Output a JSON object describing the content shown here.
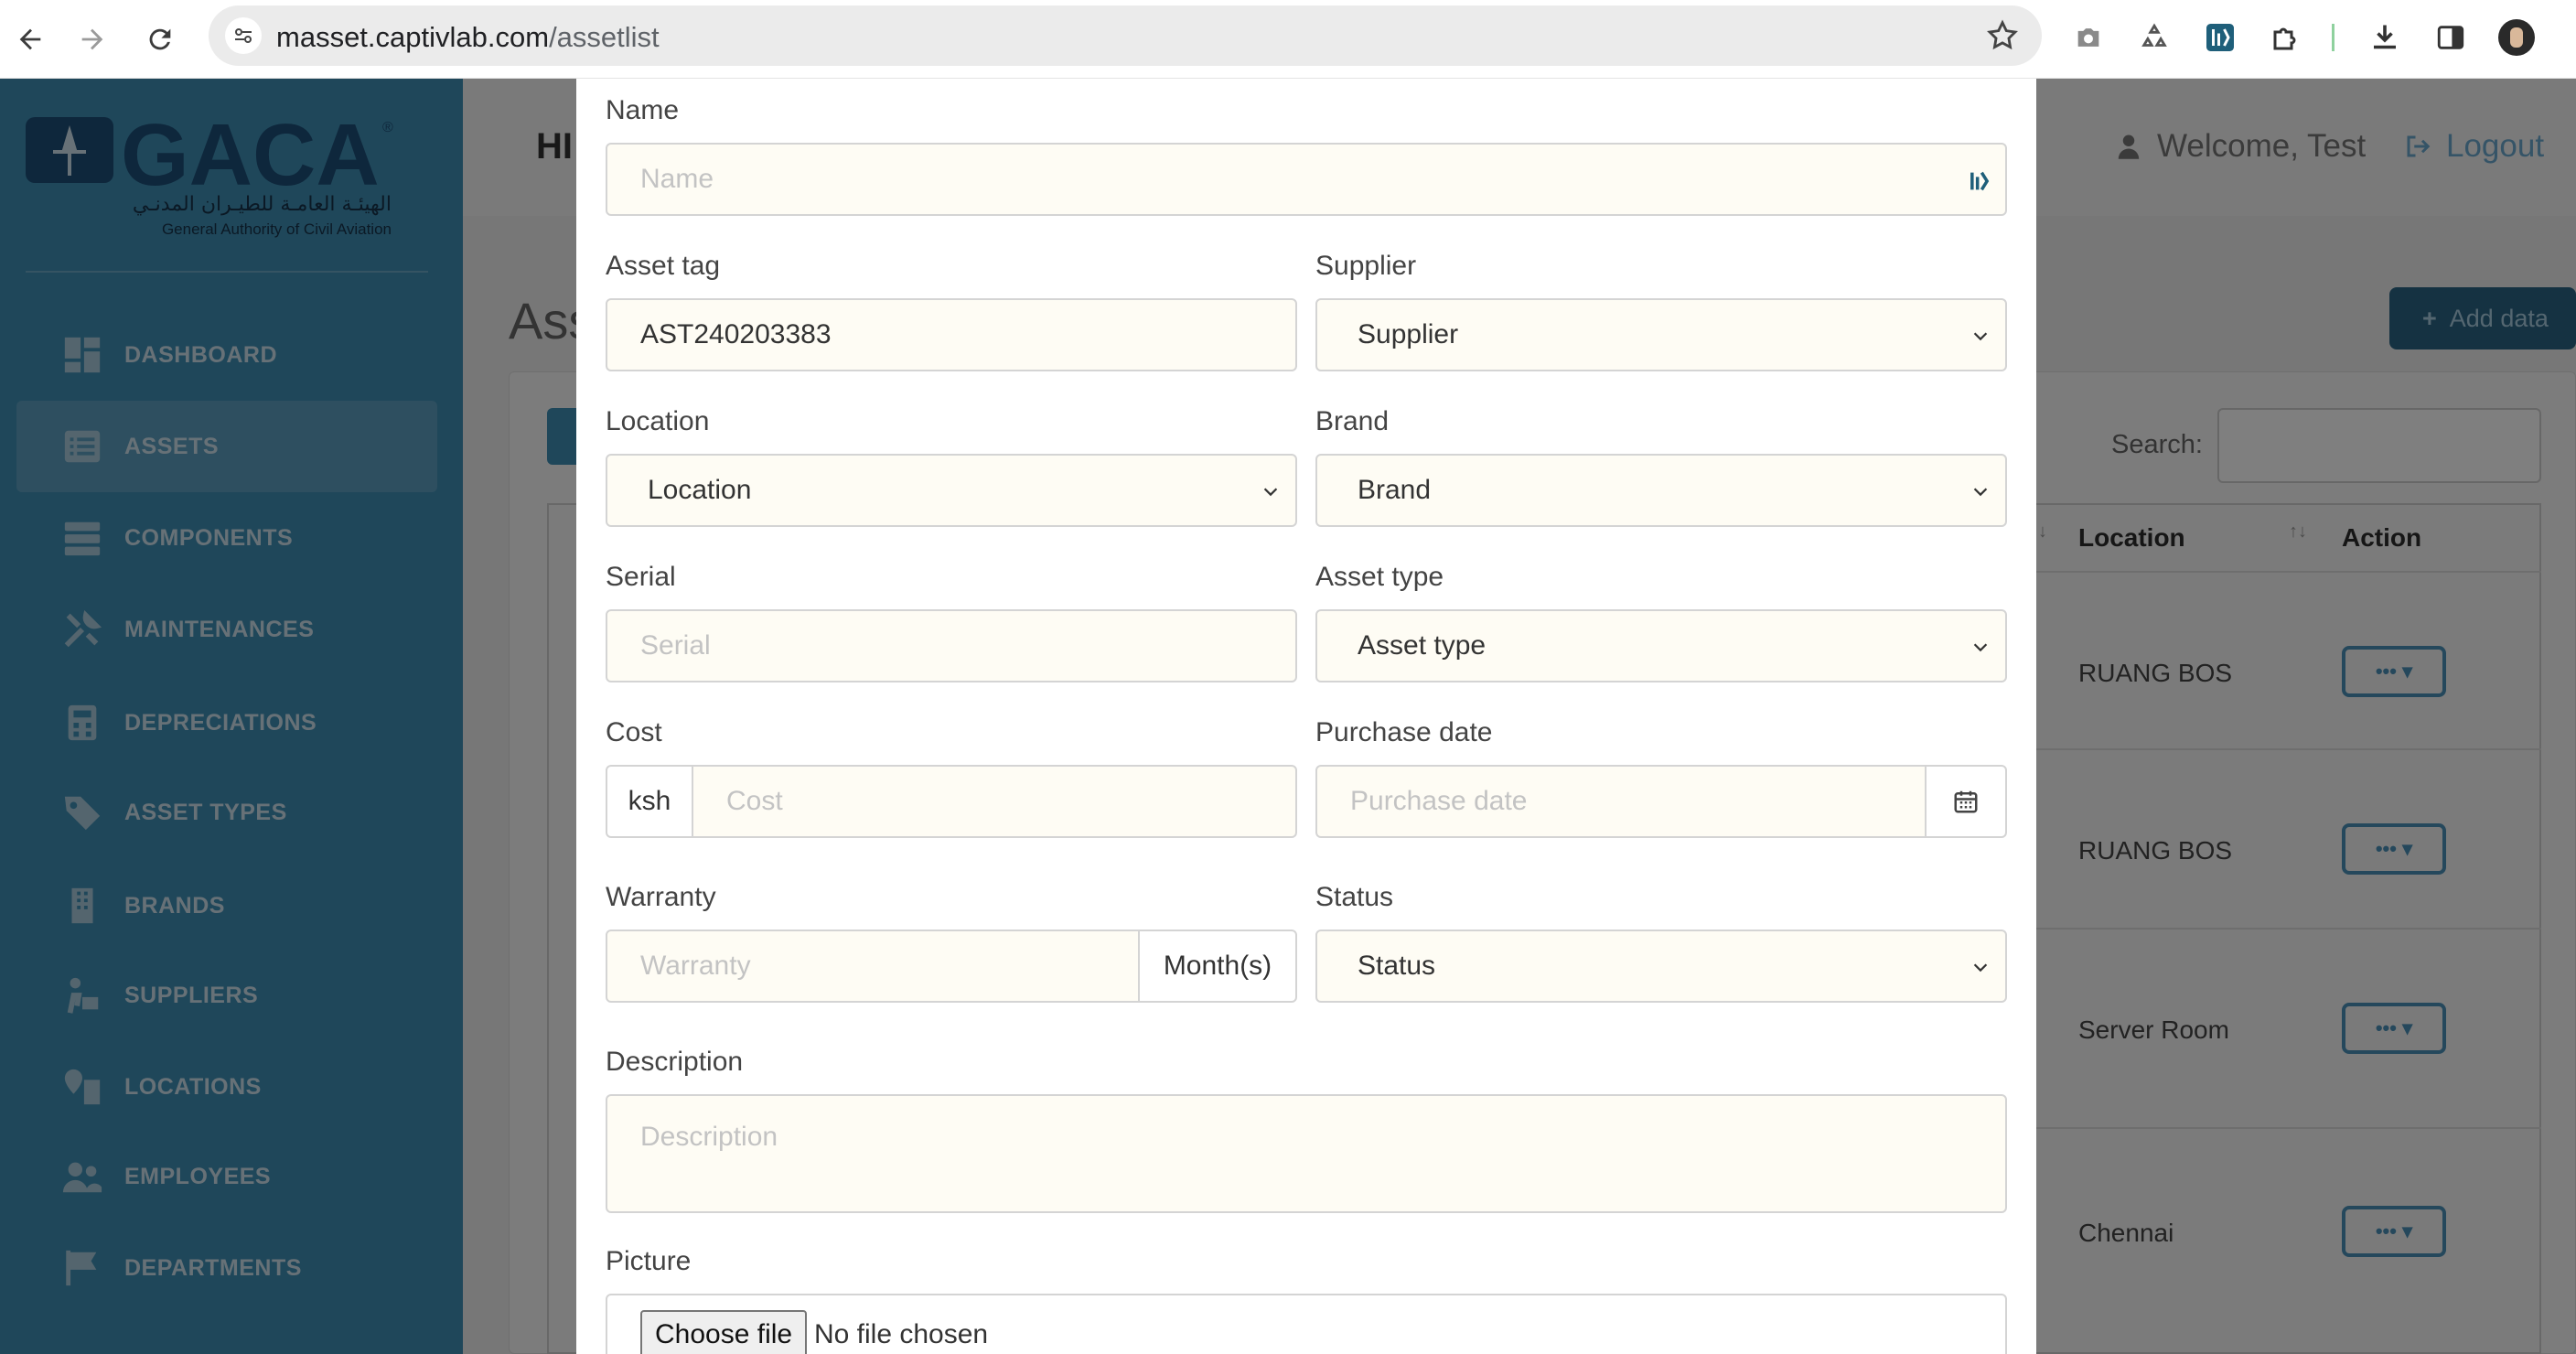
{
  "browser": {
    "url_host": "masset.captivlab.com",
    "url_path": "/assetlist"
  },
  "sidebar": {
    "logo_text": "GACA",
    "logo_arabic": "الهيئـة العامـة للطيـران المدنـي",
    "logo_sub": "General Authority of Civil Aviation",
    "items": [
      {
        "label": "DASHBOARD",
        "icon": "dashboard-icon"
      },
      {
        "label": "ASSETS",
        "icon": "list-icon",
        "active": true
      },
      {
        "label": "COMPONENTS",
        "icon": "server-icon"
      },
      {
        "label": "MAINTENANCES",
        "icon": "tools-icon"
      },
      {
        "label": "DEPRECIATIONS",
        "icon": "calculator-icon"
      },
      {
        "label": "ASSET TYPES",
        "icon": "tag-icon"
      },
      {
        "label": "BRANDS",
        "icon": "building-icon"
      },
      {
        "label": "SUPPLIERS",
        "icon": "dolly-icon"
      },
      {
        "label": "LOCATIONS",
        "icon": "map-pin-icon"
      },
      {
        "label": "EMPLOYEES",
        "icon": "users-icon"
      },
      {
        "label": "DEPARTMENTS",
        "icon": "flag-icon"
      }
    ]
  },
  "header": {
    "title_partial": "HI",
    "welcome": "Welcome, Test",
    "logout": "Logout"
  },
  "page": {
    "heading_partial": "Ass",
    "add_button": "Add data",
    "search_label": "Search:"
  },
  "table": {
    "headers": {
      "location": "Location",
      "action": "Action"
    },
    "rows": [
      {
        "location": "RUANG BOS"
      },
      {
        "location": "RUANG BOS"
      },
      {
        "location": "Server Room"
      },
      {
        "location": "Chennai"
      }
    ],
    "action_glyph": "•••"
  },
  "form": {
    "name": {
      "label": "Name",
      "placeholder": "Name"
    },
    "asset_tag": {
      "label": "Asset tag",
      "value": "AST240203383"
    },
    "supplier": {
      "label": "Supplier",
      "selected": "Supplier"
    },
    "location": {
      "label": "Location",
      "selected": "Location"
    },
    "brand": {
      "label": "Brand",
      "selected": "Brand"
    },
    "serial": {
      "label": "Serial",
      "placeholder": "Serial"
    },
    "asset_type": {
      "label": "Asset type",
      "selected": "Asset type"
    },
    "cost": {
      "label": "Cost",
      "prefix": "ksh",
      "placeholder": "Cost"
    },
    "purchase_date": {
      "label": "Purchase date",
      "placeholder": "Purchase date"
    },
    "warranty": {
      "label": "Warranty",
      "placeholder": "Warranty",
      "suffix": "Month(s)"
    },
    "status": {
      "label": "Status",
      "selected": "Status"
    },
    "description": {
      "label": "Description",
      "placeholder": "Description"
    },
    "picture": {
      "label": "Picture",
      "button": "Choose file",
      "status": "No file chosen"
    }
  }
}
